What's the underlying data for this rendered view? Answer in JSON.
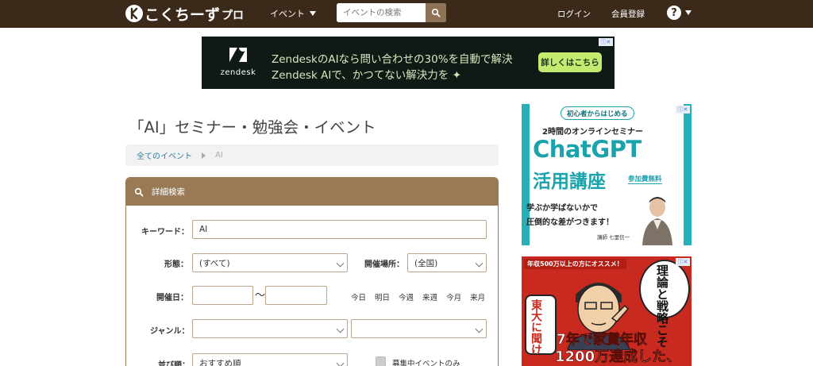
{
  "header": {
    "logo_text": "こくちーず",
    "logo_sub": "プロ",
    "nav_event_label": "イベント",
    "search_placeholder": "イベントの検索",
    "login_label": "ログイン",
    "register_label": "会員登録",
    "help_label": "?"
  },
  "ad_top": {
    "brand": "zendesk",
    "line1": "ZendeskのAIなら問い合わせの30%を自動で解決",
    "line2": "Zendesk AIで、かつてない解決力を ✦",
    "cta": "詳しくはこちら",
    "bg_color": "#0f1a14",
    "cta_color": "#c4ea70"
  },
  "main": {
    "page_title": "「AI」セミナー・勉強会・イベント",
    "breadcrumb": {
      "all_events": "全てのイベント",
      "current": "AI"
    },
    "search_panel": {
      "title": "詳細検索",
      "keyword_label": "キーワード：",
      "keyword_value": "AI",
      "format_label": "形態：",
      "format_value": "(すべて)",
      "location_label": "開催場所：",
      "location_value": "(全国)",
      "date_label": "開催日：",
      "date_from": "",
      "date_to": "",
      "date_tilde": "〜",
      "date_shortcuts": [
        "今日",
        "明日",
        "今週",
        "来週",
        "今月",
        "来月"
      ],
      "genre_label": "ジャンル：",
      "genre_value1": "",
      "genre_value2": "",
      "sort_label": "並び順：",
      "sort_value": "おすすめ順",
      "recruiting_only_label": "募集中イベントのみ",
      "accent_color": "#9a7a55"
    }
  },
  "sidebar": {
    "ad1": {
      "badge": "初心者からはじめる",
      "subtitle": "2時間のオンラインセミナー",
      "title": "ChatGPT",
      "title2": "活用講座",
      "free": "参加費無料",
      "line1": "学ぶか学ばないかで",
      "line2": "圧倒的な差がつきます！",
      "instructor": "講師 七里信一",
      "accent_color": "#1aa3ad"
    },
    "ad2": {
      "top_text": "年収500万以上の方にオススメ！",
      "bubble1": "理論と戦略こそ",
      "bubble2": "東大に聞け！",
      "bottom1": "7年で家賃年収",
      "bottom2": "1200万達成した、",
      "bg_color": "#c92a1f"
    }
  }
}
